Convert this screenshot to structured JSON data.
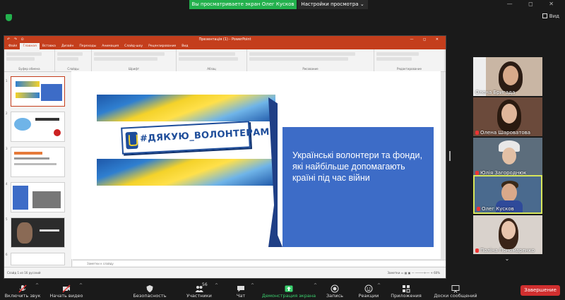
{
  "topbar": {
    "share_banner": "Вы просматриваете экран Олег Кусков",
    "view_options": "Настройки просмотра ⌄",
    "window_controls": "— ◻ ✕",
    "view_button": "Вид"
  },
  "ppt": {
    "window_title": "Презентація (1) - PowerPoint",
    "quick_access": "↶ ↷ ⊙",
    "window_controls": "— ◻ ✕",
    "tabs": [
      "Файл",
      "Главная",
      "Вставка",
      "Дизайн",
      "Переходы",
      "Анимация",
      "Слайд-шоу",
      "Рецензирование",
      "Вид"
    ],
    "ribbon_groups": [
      "Буфер обмена",
      "Слайды",
      "Шрифт",
      "Абзац",
      "Рисование",
      "Редактирование"
    ],
    "notes_placeholder": "Заметки к слайду",
    "status_left": "Слайд 1 из 16   русский",
    "status_zoom": "Заметки   ▭ ▦ ▣   —  ─────+──  +  60%"
  },
  "slide": {
    "banner_text": "#ДЯКУЮ_ВОЛОНТЕРАМ",
    "box_text": "Українські волонтери та фонди, які найбільше допомагають країні під час війни"
  },
  "participants": [
    {
      "name": "Олена Бригада",
      "muted": false
    },
    {
      "name": "Олена Шароватова",
      "muted": true
    },
    {
      "name": "Юлія Загороднюк",
      "muted": true
    },
    {
      "name": "Олег Кусков",
      "muted": true
    },
    {
      "name": "Поліна Пономаренко",
      "muted": true
    }
  ],
  "toolbar": {
    "unmute": "Включить звук",
    "start_video": "Начать видео",
    "security": "Безопасность",
    "participants": "Участники",
    "participants_count": "56",
    "chat": "Чат",
    "share_screen": "Демонстрация экрана",
    "record": "Запись",
    "reactions": "Реакции",
    "apps": "Приложения",
    "whiteboards": "Доски сообщений",
    "end": "Завершение"
  },
  "colors": {
    "share_green": "#23b14d",
    "end_red": "#d12f2f",
    "ppt_accent": "#c43e1c",
    "slide_blue": "#3d6cc7",
    "active_speaker": "#d8e65a"
  }
}
